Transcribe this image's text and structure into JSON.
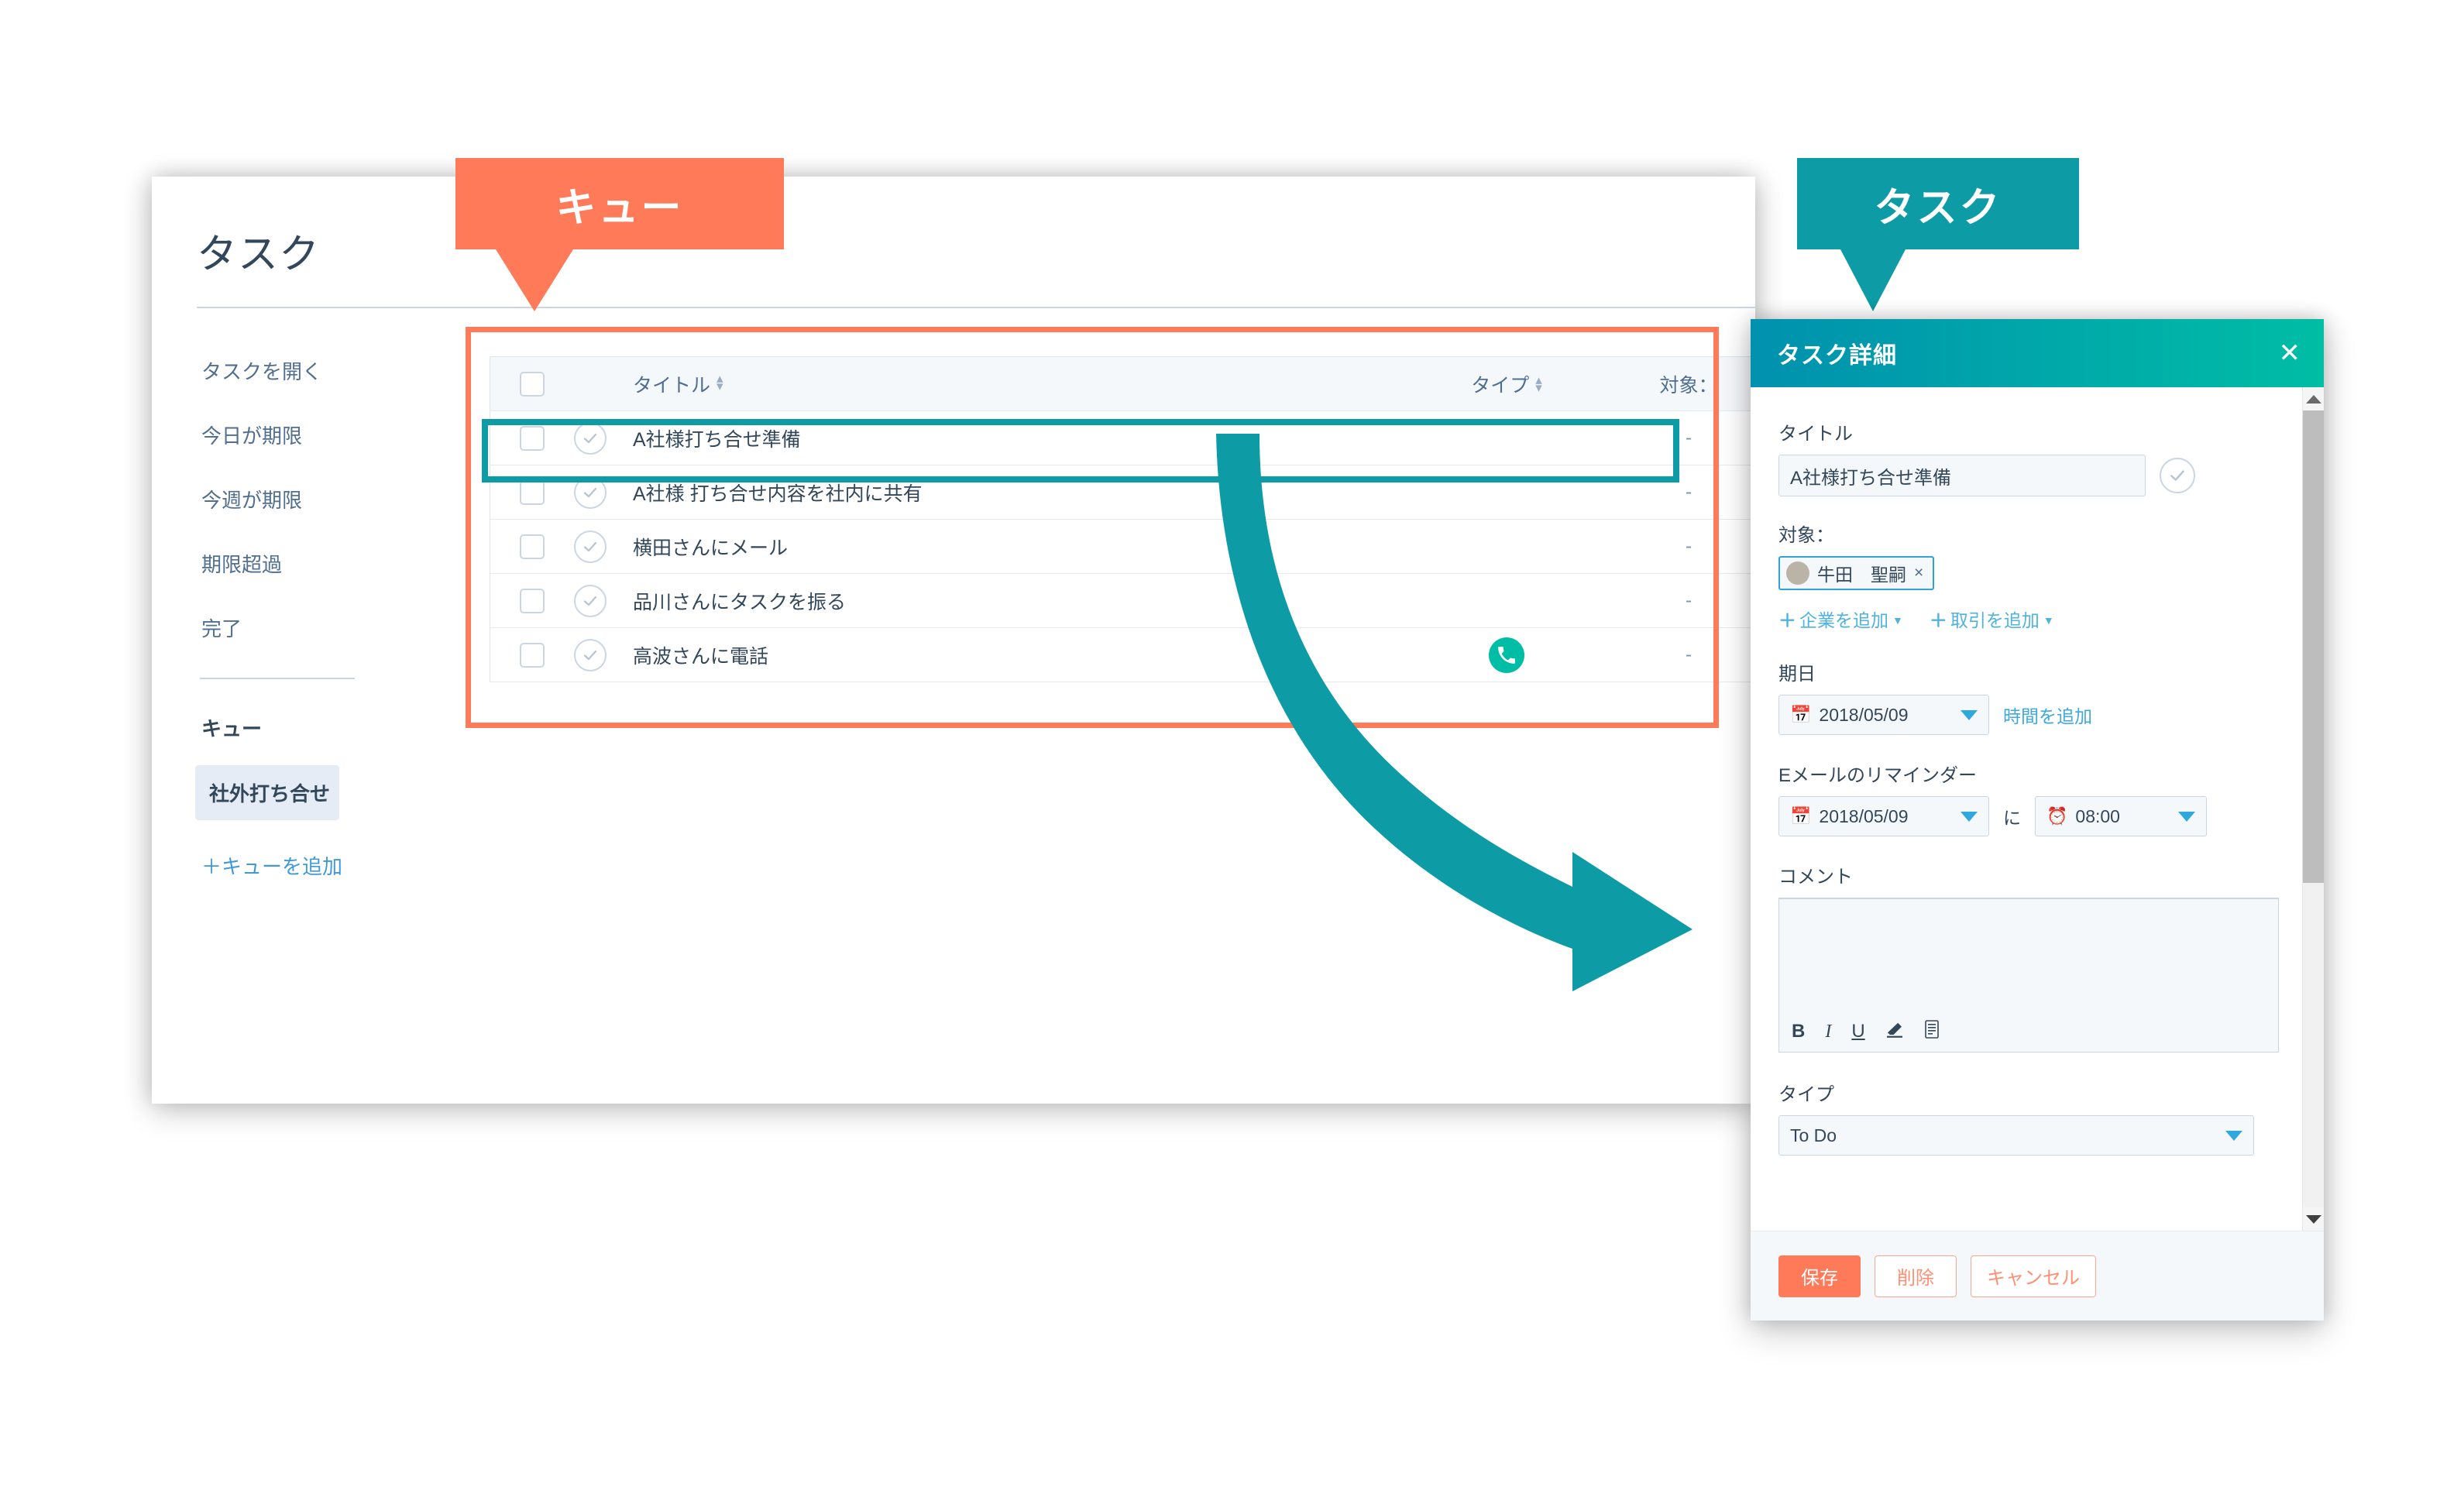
{
  "app": {
    "page_title": "タスク"
  },
  "sidebar": {
    "links": [
      {
        "label": "タスクを開く"
      },
      {
        "label": "今日が期限"
      },
      {
        "label": "今週が期限"
      },
      {
        "label": "期限超過"
      },
      {
        "label": "完了"
      }
    ],
    "queue_heading": "キュー",
    "selected_queue": "社外打ち合せ",
    "add_queue": "＋キューを追加"
  },
  "table": {
    "columns": {
      "title": "タイトル",
      "type": "タイプ",
      "target": "対象："
    },
    "rows": [
      {
        "title": "A社様打ち合せ準備",
        "type_icon": "",
        "target": "-"
      },
      {
        "title": "A社様 打ち合せ内容を社内に共有",
        "type_icon": "",
        "target": "-"
      },
      {
        "title": "横田さんにメール",
        "type_icon": "",
        "target": "-"
      },
      {
        "title": "品川さんにタスクを振る",
        "type_icon": "",
        "target": "-"
      },
      {
        "title": "高波さんに電話",
        "type_icon": "phone-icon",
        "target": "-"
      }
    ]
  },
  "callouts": {
    "queue": "キュー",
    "task": "タスク"
  },
  "panel": {
    "header_title": "タスク詳細",
    "close_label": "✕",
    "title_field": {
      "label": "タイトル",
      "value": "A社様打ち合せ準備"
    },
    "target_field": {
      "label": "対象：",
      "assignee": "牛田　聖嗣",
      "remove_label": "×",
      "add_company": "企業を追加",
      "add_deal": "取引を追加"
    },
    "due_field": {
      "label": "期日",
      "date": "2018/05/09",
      "add_time_link": "時間を追加"
    },
    "reminder_field": {
      "label": "Eメールのリマインダー",
      "date": "2018/05/09",
      "conjunction": "に",
      "time": "08:00"
    },
    "comment_field": {
      "label": "コメント",
      "value": "",
      "toolbar": [
        "B",
        "I",
        "U",
        "clear-format-icon",
        "more-icon"
      ]
    },
    "type_field": {
      "label": "タイプ",
      "value": "To Do"
    },
    "footer": {
      "save": "保存",
      "delete": "削除",
      "cancel": "キャンセル"
    }
  },
  "colors": {
    "orange": "#ff7a59",
    "teal": "#0d9ba5",
    "green": "#00bda5",
    "slate": "#33475b",
    "link_blue": "#4fb3dd"
  }
}
